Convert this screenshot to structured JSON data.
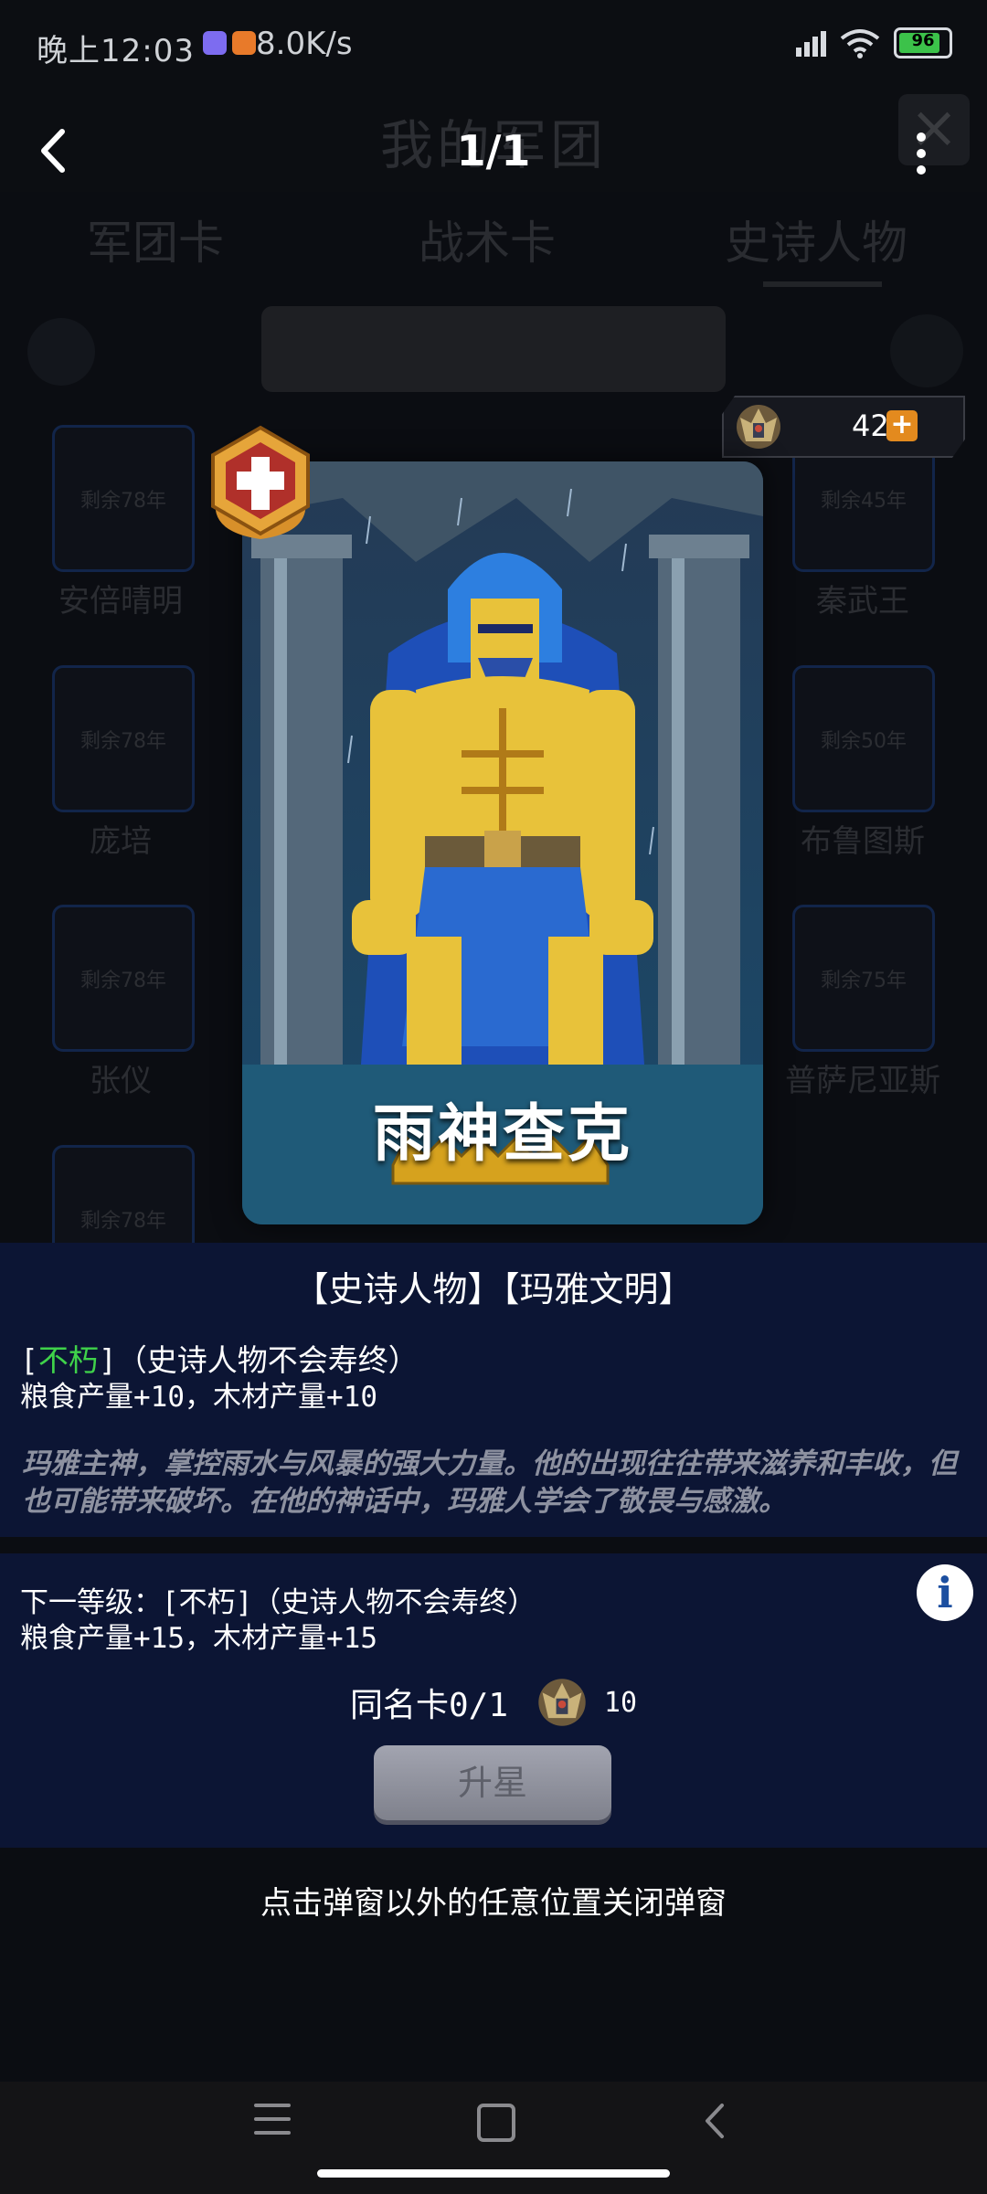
{
  "status_bar": {
    "time": "晚上12:03",
    "speed": "8.0K/s",
    "battery": "96"
  },
  "background": {
    "title": "我的军团",
    "tabs": [
      "军团卡",
      "战术卡",
      "史诗人物"
    ],
    "cards": [
      {
        "name": "安倍晴明",
        "remain": "剩余78年"
      },
      {
        "name": "秦武王",
        "remain": "剩余45年"
      },
      {
        "name": "庞培",
        "remain": "剩余78年"
      },
      {
        "name": "布鲁图斯",
        "remain": "剩余50年"
      },
      {
        "name": "张仪",
        "remain": "剩余78年"
      },
      {
        "name": "普萨尼亚斯",
        "remain": "剩余75年"
      },
      {
        "name": "",
        "remain": "剩余78年"
      }
    ]
  },
  "header": {
    "page_counter": "1/1"
  },
  "resource": {
    "count": "42",
    "icon": "crest-icon"
  },
  "card": {
    "name": "雨神查克",
    "badge_icon": "cross-medal-icon"
  },
  "details": {
    "tags": "【史诗人物】【玛雅文明】",
    "trait_open": "[",
    "trait_name": "不朽",
    "trait_rest": "]（史诗人物不会寿终）",
    "production": "粮食产量+10，木材产量+10",
    "lore": "玛雅主神，掌控雨水与风暴的强大力量。他的出现往往带来滋养和丰收，但也可能带来破坏。在他的神话中，玛雅人学会了敬畏与感激。"
  },
  "next_level": {
    "line1": "下一等级：[不朽]（史诗人物不会寿终）",
    "line2": "粮食产量+15，木材产量+15",
    "duplicate_label": "同名卡0/1",
    "cost": "10",
    "upgrade_label": "升星"
  },
  "close_hint": "点击弹窗以外的任意位置关闭弹窗"
}
